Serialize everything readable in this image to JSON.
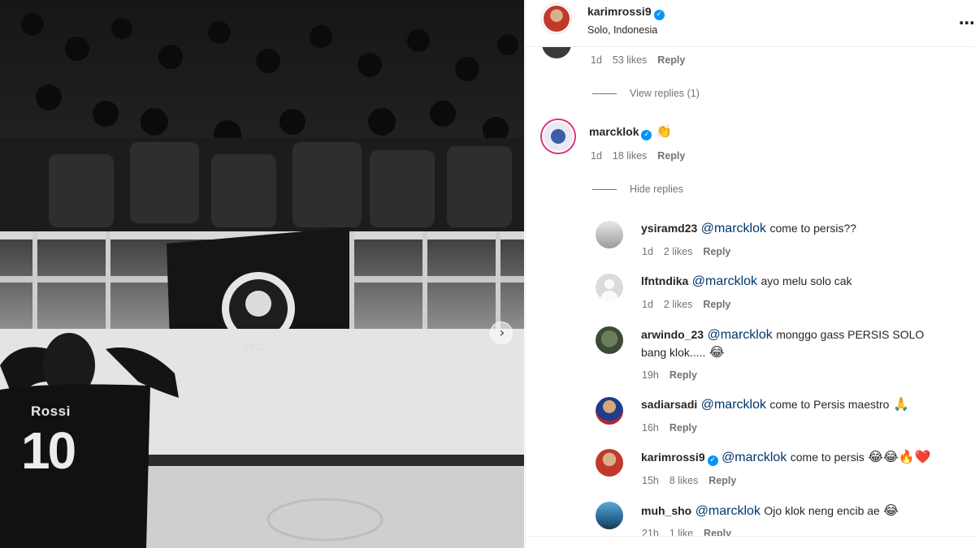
{
  "post": {
    "author": "karimrossi9",
    "location": "Solo, Indonesia",
    "photo": {
      "jersey_name": "Rossi",
      "jersey_number": "10",
      "banner_text": "1923",
      "next_icon": "chevron-right-icon"
    }
  },
  "partial_comment": {
    "time": "1d",
    "likes": "53 likes",
    "reply": "Reply"
  },
  "view_replies": "View replies (1)",
  "main_comment": {
    "username": "marcklok",
    "emoji": "👏",
    "time": "1d",
    "likes": "18 likes",
    "reply": "Reply",
    "hide_replies": "Hide replies"
  },
  "replies": [
    {
      "username": "ysiramd23",
      "mention": "@marcklok",
      "text": "come to persis??",
      "time": "1d",
      "likes": "2 likes",
      "reply": "Reply"
    },
    {
      "username": "lfntndika",
      "mention": "@marcklok",
      "text": "ayo melu solo cak",
      "time": "1d",
      "likes": "2 likes",
      "reply": "Reply"
    },
    {
      "username": "arwindo_23",
      "mention": "@marcklok",
      "text": "monggo gass PERSIS SOLO",
      "text2": "bang klok.....",
      "emoji": "😂",
      "time": "19h",
      "reply": "Reply"
    },
    {
      "username": "sadiarsadi",
      "mention": "@marcklok",
      "text": "come to Persis maestro",
      "emoji": "🙏",
      "time": "16h",
      "reply": "Reply"
    },
    {
      "username": "karimrossi9",
      "mention": "@marcklok",
      "text": "come to persis",
      "emoji": "😂😂🔥❤️",
      "time": "15h",
      "likes": "8 likes",
      "reply": "Reply"
    },
    {
      "username": "muh_sho",
      "mention": "@marcklok",
      "text": "Ojo klok neng encib ae",
      "emoji": "😂",
      "time": "21h",
      "likes": "1 like",
      "reply": "Reply"
    }
  ],
  "colors": {
    "verified": "#0095f6",
    "mention": "#00376b",
    "meta": "#737373"
  }
}
